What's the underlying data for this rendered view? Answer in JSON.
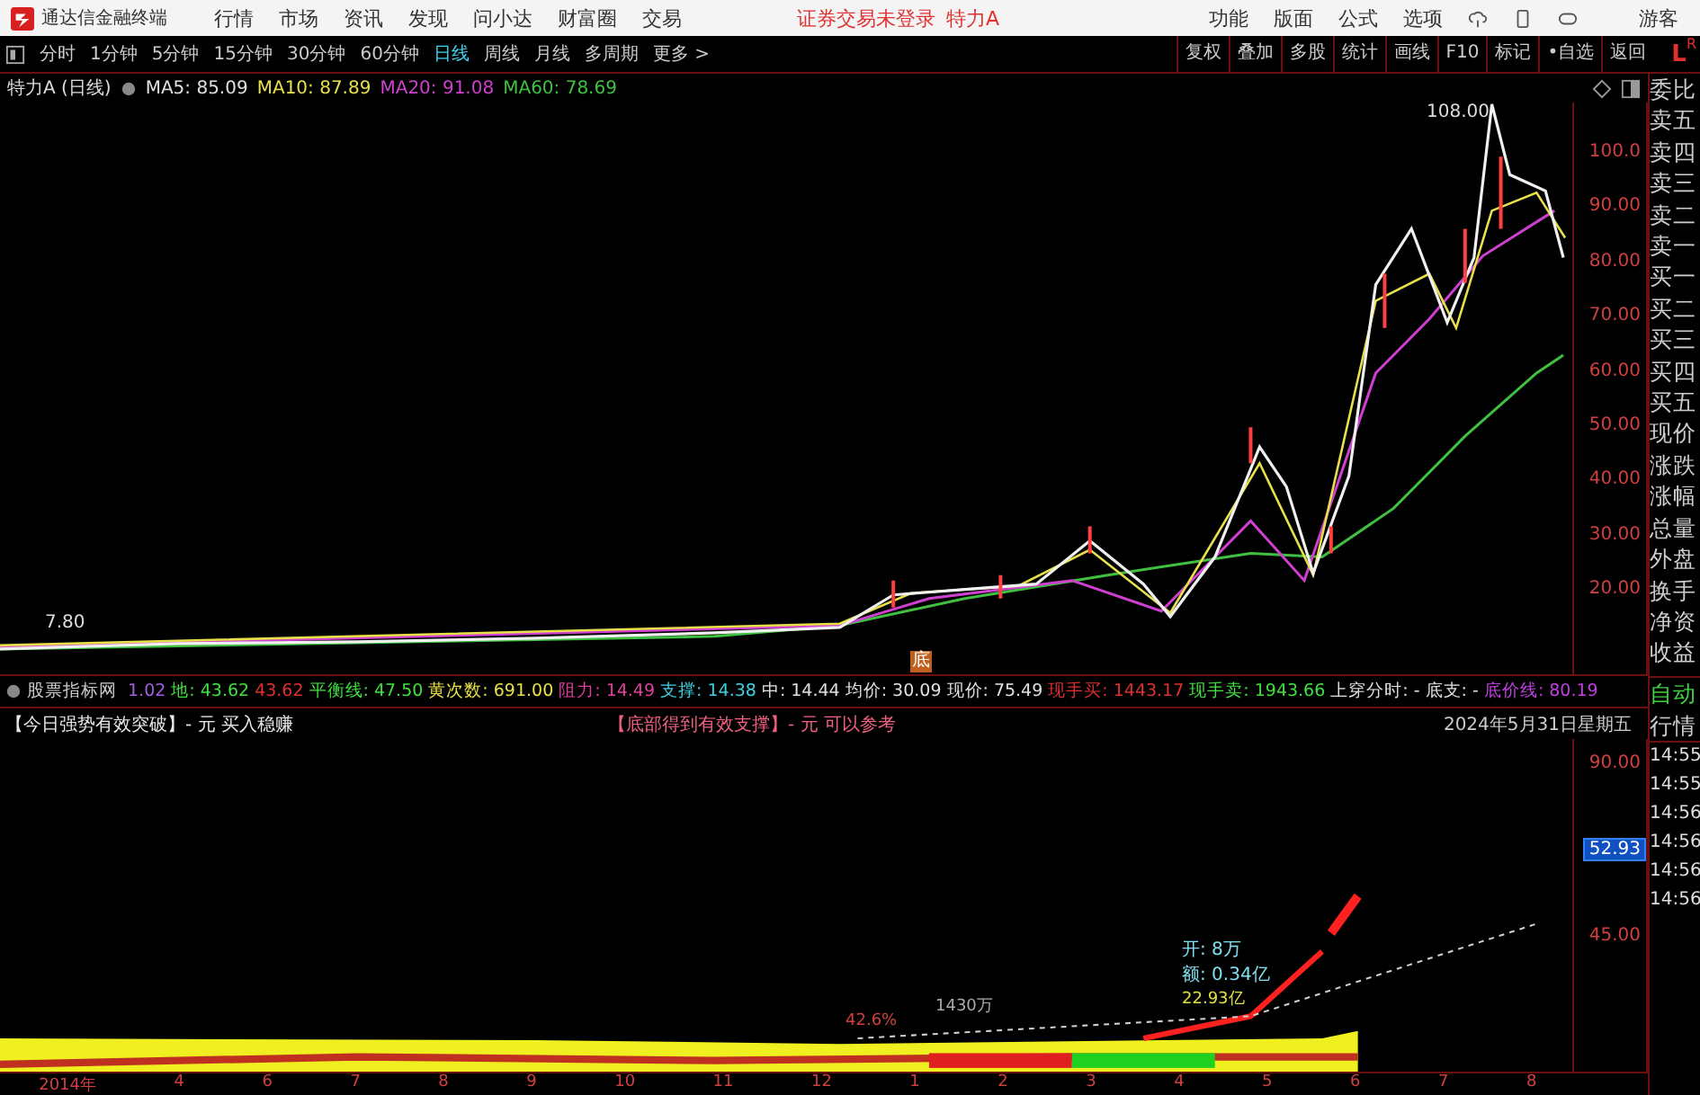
{
  "window": {
    "app_name": "通达信金融终端",
    "menu": [
      "行情",
      "市场",
      "资讯",
      "发现",
      "问小达",
      "财富圈",
      "交易"
    ],
    "login_notice": "证券交易未登录",
    "stock_name": "特力A",
    "actions": [
      "功能",
      "版面",
      "公式",
      "选项"
    ],
    "user": "游客"
  },
  "periods": [
    {
      "label": "分时",
      "selected": false
    },
    {
      "label": "1分钟",
      "selected": false
    },
    {
      "label": "5分钟",
      "selected": false
    },
    {
      "label": "15分钟",
      "selected": false
    },
    {
      "label": "30分钟",
      "selected": false
    },
    {
      "label": "60分钟",
      "selected": false
    },
    {
      "label": "日线",
      "selected": true
    },
    {
      "label": "周线",
      "selected": false
    },
    {
      "label": "月线",
      "selected": false
    },
    {
      "label": "多周期",
      "selected": false
    },
    {
      "label": "更多 >",
      "selected": false
    }
  ],
  "tools": [
    "复权",
    "叠加",
    "多股",
    "统计",
    "画线",
    "F10",
    "标记",
    "•自选",
    "返回"
  ],
  "corner": {
    "left": "L",
    "right": "R"
  },
  "legend": {
    "title": "特力A (日线)",
    "items": [
      {
        "text": "MA5: 85.09",
        "color": "#e0e0e0"
      },
      {
        "text": "MA10: 87.89",
        "color": "#e8e04a"
      },
      {
        "text": "MA20: 91.08",
        "color": "#d040d0"
      },
      {
        "text": "MA60: 78.69",
        "color": "#40c040"
      }
    ]
  },
  "price_chart": {
    "high_label": "108.00",
    "low_label": "7.80",
    "bottom_mark": "底",
    "axis": [
      "100.0",
      "90.00",
      "80.00",
      "70.00",
      "60.00",
      "50.00",
      "40.00",
      "30.00",
      "20.00"
    ]
  },
  "sidebar": {
    "labels": [
      "委比",
      "卖五",
      "卖四",
      "卖三",
      "卖二",
      "卖一",
      "买一",
      "买二",
      "买三",
      "买四",
      "买五",
      "现价",
      "涨跌",
      "涨幅",
      "总量",
      "外盘",
      "换手",
      "净资",
      "收益"
    ],
    "mode": [
      "自动",
      "行情"
    ],
    "times": [
      "14:55",
      "14:55",
      "14:56",
      "14:56",
      "14:56",
      "14:56"
    ]
  },
  "indicator": {
    "name": "股票指标网",
    "items": [
      {
        "text": "1.02",
        "color": "#a060e0"
      },
      {
        "text": "地:",
        "color": "#40e040"
      },
      {
        "text": "43.62",
        "color": "#40e040"
      },
      {
        "text": "43.62",
        "color": "#e03030"
      },
      {
        "text": "平衡线:",
        "color": "#40e040"
      },
      {
        "text": "47.50",
        "color": "#40e040"
      },
      {
        "text": "黄次数:",
        "color": "#e8e04a"
      },
      {
        "text": "691.00",
        "color": "#e8e04a"
      },
      {
        "text": "阻力:",
        "color": "#e040a0"
      },
      {
        "text": "14.49",
        "color": "#e040a0"
      },
      {
        "text": "支撑:",
        "color": "#40d0e0"
      },
      {
        "text": "14.38",
        "color": "#40d0e0"
      },
      {
        "text": "中:",
        "color": "#e0e0e0"
      },
      {
        "text": "14.44",
        "color": "#e0e0e0"
      },
      {
        "text": "均价:",
        "color": "#e0e0e0"
      },
      {
        "text": "30.09",
        "color": "#e0e0e0"
      },
      {
        "text": "现价:",
        "color": "#e0e0e0"
      },
      {
        "text": "75.49",
        "color": "#e0e0e0"
      },
      {
        "text": "现手买:",
        "color": "#e03030"
      },
      {
        "text": "1443.17",
        "color": "#e03030"
      },
      {
        "text": "现手卖:",
        "color": "#40e040"
      },
      {
        "text": "1943.66",
        "color": "#40e040"
      },
      {
        "text": "上穿分时:",
        "color": "#e0e0e0"
      },
      {
        "text": "-",
        "color": "#e0e0e0"
      },
      {
        "text": "底支:",
        "color": "#e0e0e0"
      },
      {
        "text": "-",
        "color": "#e0e0e0"
      },
      {
        "text": "底价线:",
        "color": "#c040e0"
      },
      {
        "text": "80.19",
        "color": "#c040e0"
      }
    ]
  },
  "signals": [
    {
      "text": "【今日强势有效突破】- 元 买入稳赚",
      "color": "#e8e8e8"
    },
    {
      "text": "【底部得到有效支撑】- 元 可以参考",
      "color": "#f06080"
    }
  ],
  "date": "2024年5月31日星期五",
  "lower_chart": {
    "axis": [
      "90.00",
      "45.00"
    ],
    "current": "52.93",
    "notes": [
      "开: 8万",
      "额: 0.34亿",
      "22.93亿"
    ],
    "volume": "1430万",
    "percent": "42.6%"
  },
  "time_axis": [
    "2014年",
    "4",
    "6",
    "7",
    "8",
    "9",
    "10",
    "11",
    "12",
    "1",
    "2",
    "3",
    "4",
    "5",
    "6",
    "7",
    "8"
  ]
}
